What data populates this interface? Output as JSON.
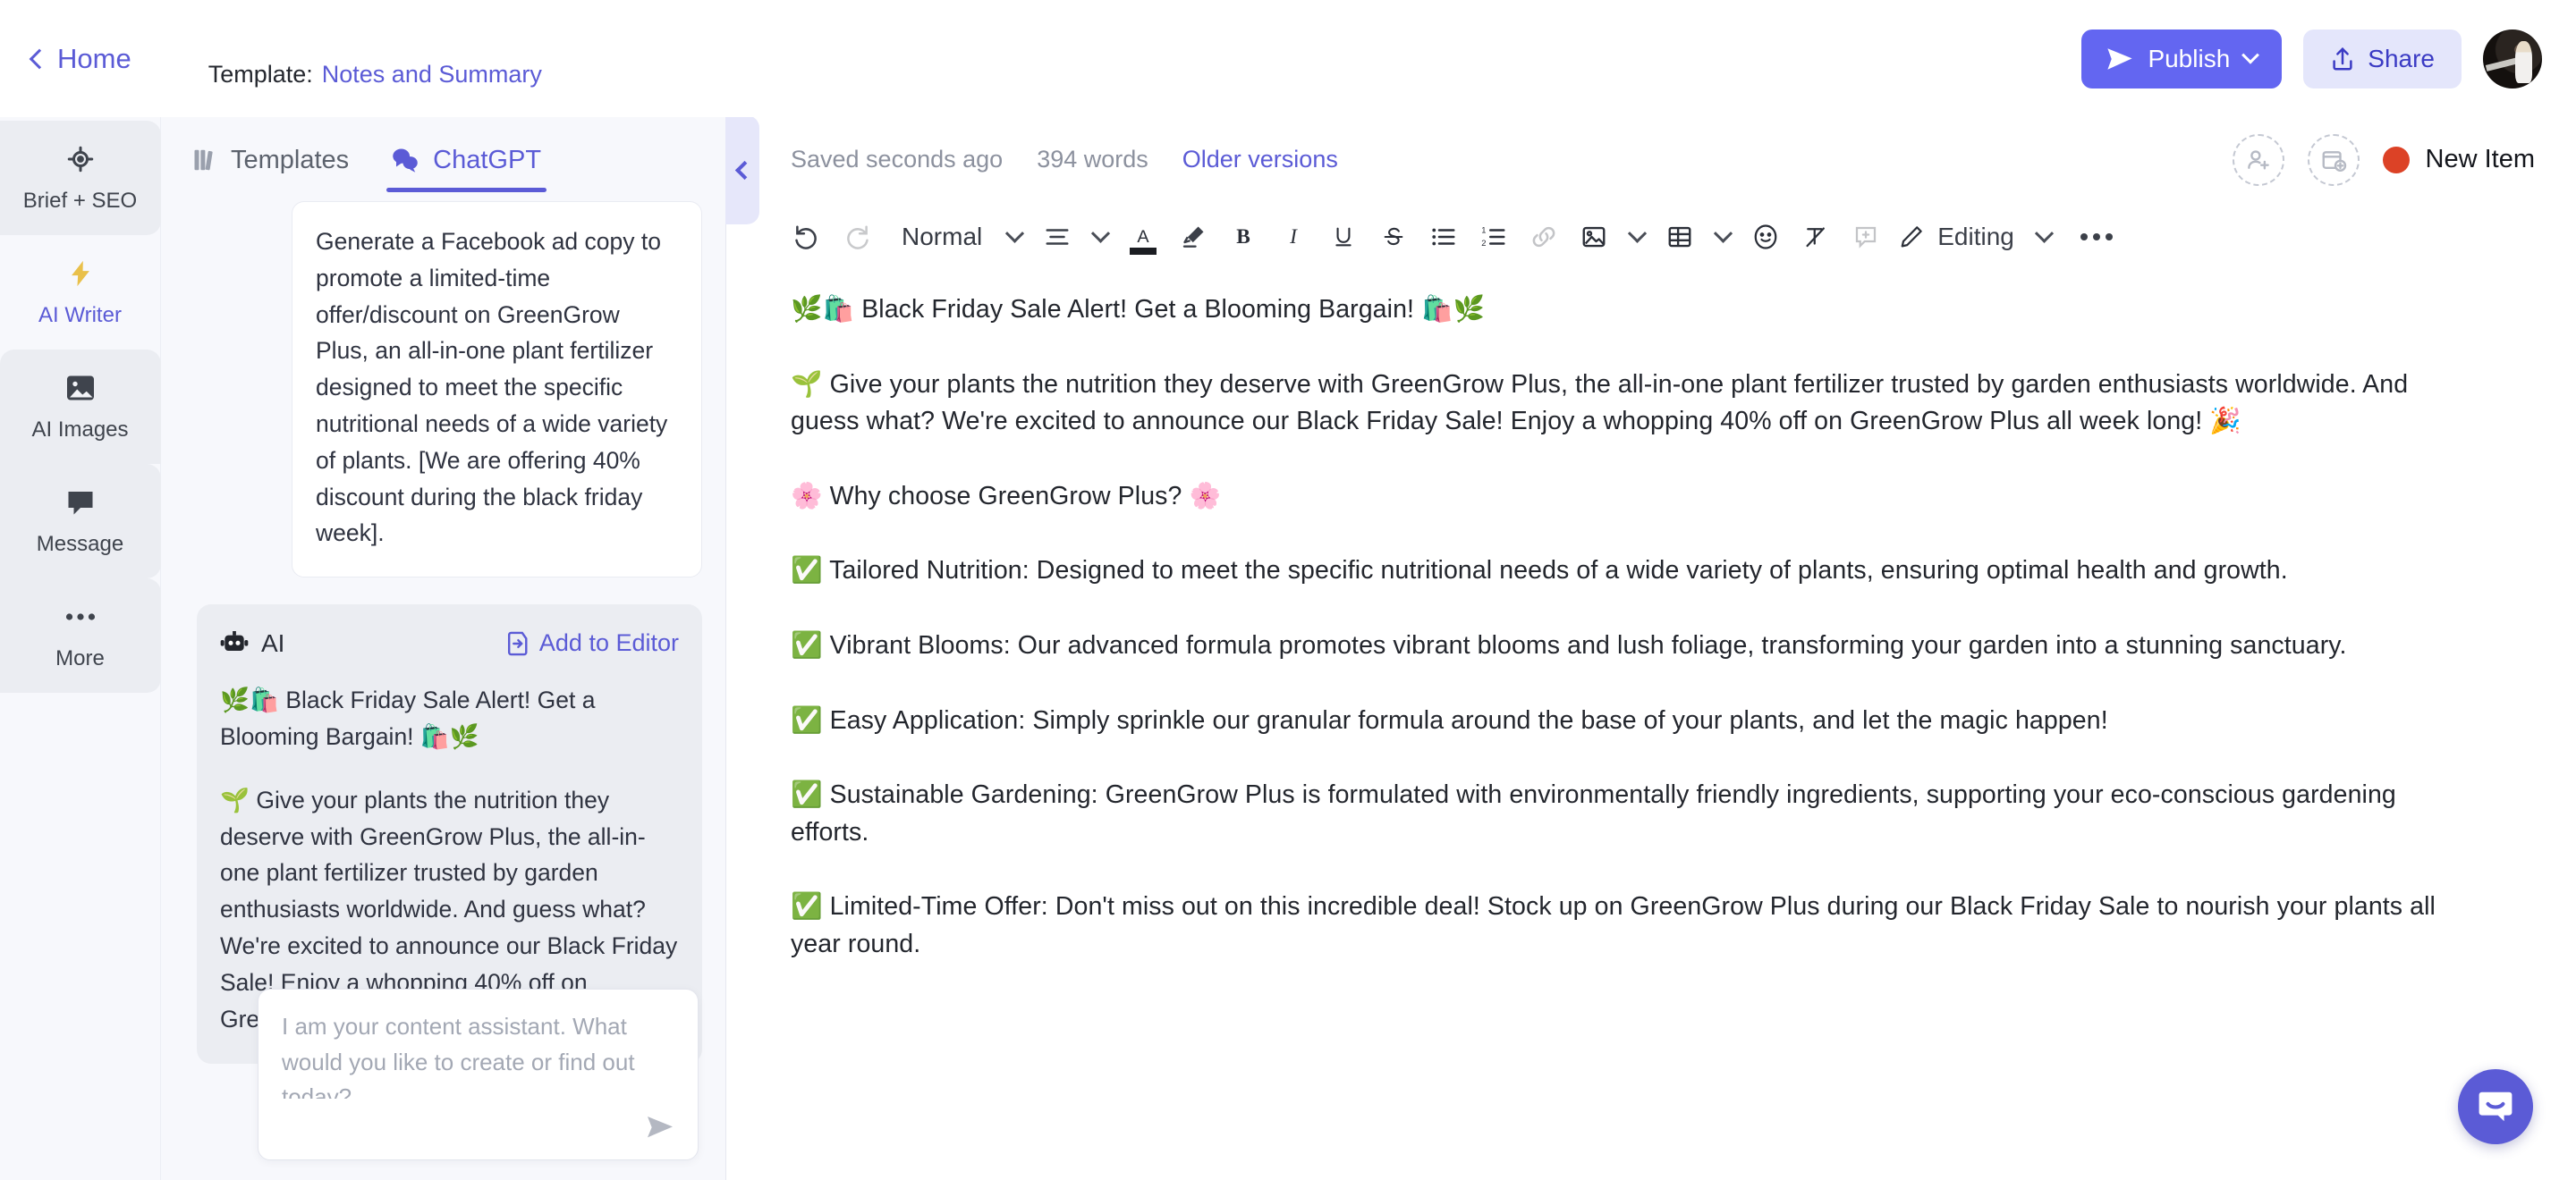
{
  "header": {
    "home_label": "Home",
    "template_label": "Template:",
    "template_name": "Notes and Summary",
    "publish_label": "Publish",
    "share_label": "Share",
    "accent_color": "#6366f1"
  },
  "rail": {
    "items": [
      {
        "label": "Brief + SEO",
        "icon": "crosshair-icon",
        "active": false
      },
      {
        "label": "AI Writer",
        "icon": "lightning-icon",
        "active": true
      },
      {
        "label": "AI Images",
        "icon": "image-icon",
        "active": false
      },
      {
        "label": "Message",
        "icon": "chat-bubble-icon",
        "active": false
      },
      {
        "label": "More",
        "icon": "ellipsis-icon",
        "active": false
      }
    ]
  },
  "panel": {
    "tabs": [
      {
        "label": "Templates",
        "icon": "books-icon",
        "active": false
      },
      {
        "label": "ChatGPT",
        "icon": "chat-bubbles-icon",
        "active": true
      }
    ],
    "user_message": "Generate a Facebook ad copy to promote a limited-time offer/discount on GreenGrow Plus, an all-in-one plant fertilizer designed to meet the specific nutritional needs of a wide variety of plants. [We are offering 40% discount during the black friday week].",
    "ai_label": "AI",
    "add_to_editor_label": "Add to Editor",
    "ai_message_paragraphs": [
      "🌿🛍️ Black Friday Sale Alert! Get a Blooming Bargain! 🛍️🌿",
      "🌱 Give your plants the nutrition they deserve with GreenGrow Plus, the all-in-one plant fertilizer trusted by garden enthusiasts worldwide. And guess what? We're excited to announce our Black Friday Sale! Enjoy a whopping 40% off on GreenGrow Plus all week long! 🎉"
    ],
    "composer_placeholder": "I am your content assistant. What would you like to create or find out today?",
    "composer_value": ""
  },
  "editor": {
    "saved_status": "Saved seconds ago",
    "word_count": "394 words",
    "older_versions_label": "Older versions",
    "new_item_label": "New Item",
    "new_item_color": "#dc4226",
    "toolbar": {
      "style_label": "Normal",
      "editing_label": "Editing"
    },
    "document_paragraphs": [
      "🌿🛍️ Black Friday Sale Alert! Get a Blooming Bargain! 🛍️🌿",
      "🌱 Give your plants the nutrition they deserve with GreenGrow Plus, the all-in-one plant fertilizer trusted by garden enthusiasts worldwide. And guess what? We're excited to announce our Black Friday Sale! Enjoy a whopping 40% off on GreenGrow Plus all week long! 🎉",
      "🌸 Why choose GreenGrow Plus? 🌸",
      "✅ Tailored Nutrition: Designed to meet the specific nutritional needs of a wide variety of plants, ensuring optimal health and growth.",
      "✅ Vibrant Blooms: Our advanced formula promotes vibrant blooms and lush foliage, transforming your garden into a stunning sanctuary.",
      "✅ Easy Application: Simply sprinkle our granular formula around the base of your plants, and let the magic happen!",
      "✅ Sustainable Gardening: GreenGrow Plus is formulated with environmentally friendly ingredients, supporting your eco-conscious gardening efforts.",
      "✅ Limited-Time Offer: Don't miss out on this incredible deal! Stock up on GreenGrow Plus during our Black Friday Sale to nourish your plants all year round."
    ]
  }
}
